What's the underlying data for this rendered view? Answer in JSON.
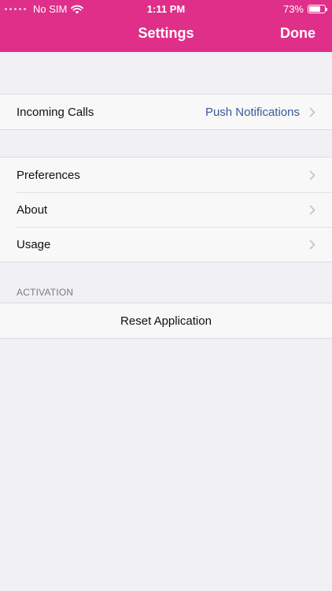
{
  "status_bar": {
    "carrier": "No SIM",
    "time": "1:11 PM",
    "battery_percent": "73%",
    "battery_level": 0.73
  },
  "nav": {
    "title": "Settings",
    "done_label": "Done"
  },
  "groups": {
    "calls": {
      "items": [
        {
          "label": "Incoming Calls",
          "value": "Push Notifications"
        }
      ]
    },
    "general": {
      "items": [
        {
          "label": "Preferences"
        },
        {
          "label": "About"
        },
        {
          "label": "Usage"
        }
      ]
    },
    "activation": {
      "header": "ACTIVATION",
      "items": [
        {
          "label": "Reset Application"
        }
      ]
    }
  },
  "colors": {
    "accent": "#df2f89",
    "background": "#f1f0f5",
    "value_text": "#3a5a9a"
  },
  "icons": [
    "wifi-icon",
    "battery-icon",
    "chevron-right-icon"
  ]
}
